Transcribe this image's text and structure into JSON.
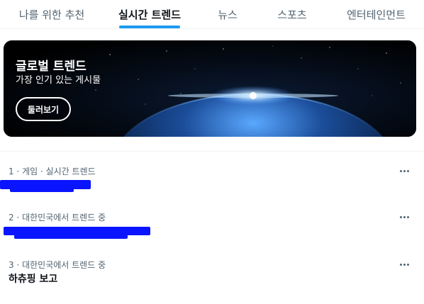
{
  "tabs": [
    {
      "label": "나를 위한 추천",
      "active": false
    },
    {
      "label": "실시간 트렌드",
      "active": true
    },
    {
      "label": "뉴스",
      "active": false
    },
    {
      "label": "스포츠",
      "active": false
    },
    {
      "label": "엔터테인먼트",
      "active": false
    }
  ],
  "banner": {
    "title": "글로벌 트렌드",
    "subtitle": "가장 인기 있는 게시물",
    "button_label": "둘러보기"
  },
  "trends": [
    {
      "meta": "1 · 게임 · 실시간 트렌드",
      "name": "",
      "redacted": true
    },
    {
      "meta": "2 · 대한민국에서 트렌드 중",
      "name": "",
      "redacted": true
    },
    {
      "meta": "3 · 대한민국에서 트렌드 중",
      "name": "하츄핑 보고",
      "redacted": false
    }
  ],
  "colors": {
    "accent": "#1d9bf0",
    "text": "#0f1419",
    "secondary": "#536471",
    "redaction": "#0a14ff"
  }
}
